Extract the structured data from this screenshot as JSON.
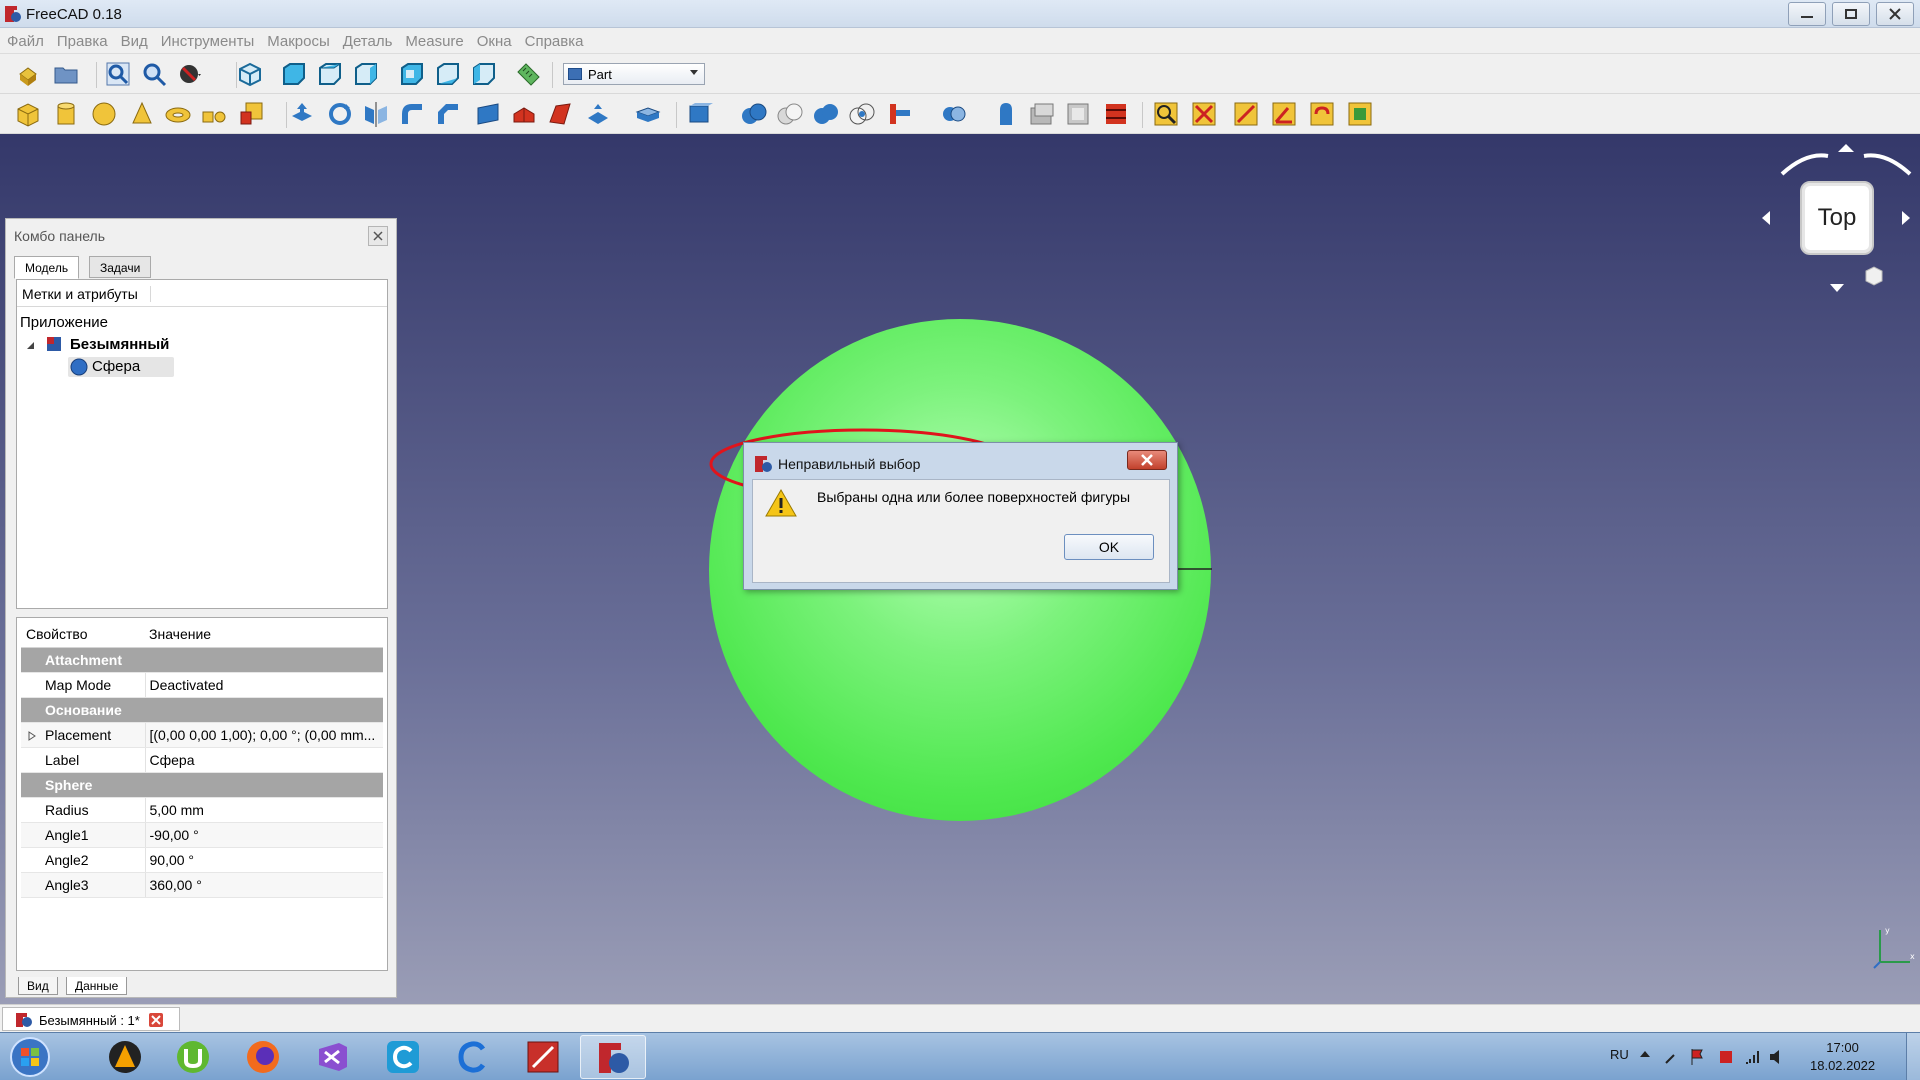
{
  "window": {
    "title": "FreeCAD 0.18"
  },
  "menu": [
    "Файл",
    "Правка",
    "Вид",
    "Инструменты",
    "Макросы",
    "Деталь",
    "Measure",
    "Окна",
    "Справка"
  ],
  "workbench": {
    "selected": "Part"
  },
  "combo_panel": {
    "title": "Комбо панель",
    "tabs": [
      "Модель",
      "Задачи"
    ],
    "tree_header": "Метки и атрибуты",
    "tree_root": "Приложение",
    "document": "Безымянный",
    "object": "Сфера",
    "prop_headers": [
      "Свойство",
      "Значение"
    ],
    "bottom_tabs": [
      "Вид",
      "Данные"
    ]
  },
  "properties": {
    "group_attachment": "Attachment",
    "map_mode_key": "Map Mode",
    "map_mode_val": "Deactivated",
    "group_base": "Основание",
    "placement_key": "Placement",
    "placement_val": "[(0,00 0,00 1,00); 0,00 °; (0,00 mm...",
    "label_key": "Label",
    "label_val": "Сфера",
    "group_sphere": "Sphere",
    "radius_key": "Radius",
    "radius_val": "5,00 mm",
    "angle1_key": "Angle1",
    "angle1_val": "-90,00 °",
    "angle2_key": "Angle2",
    "angle2_val": "90,00 °",
    "angle3_key": "Angle3",
    "angle3_val": "360,00 °"
  },
  "navcube": {
    "face": "Top"
  },
  "dialog": {
    "title": "Неправильный выбор",
    "message": "Выбраны одна или более поверхностей фигуры",
    "ok": "OK"
  },
  "doc_tab": {
    "label": "Безымянный : 1*"
  },
  "taskbar": {
    "lang": "RU",
    "time": "17:00",
    "date": "18.02.2022"
  },
  "colors": {
    "sphere": "#5cec5c",
    "annotation": "#e0141c",
    "view_top": "#34386a",
    "view_bottom": "#9a9db6"
  }
}
